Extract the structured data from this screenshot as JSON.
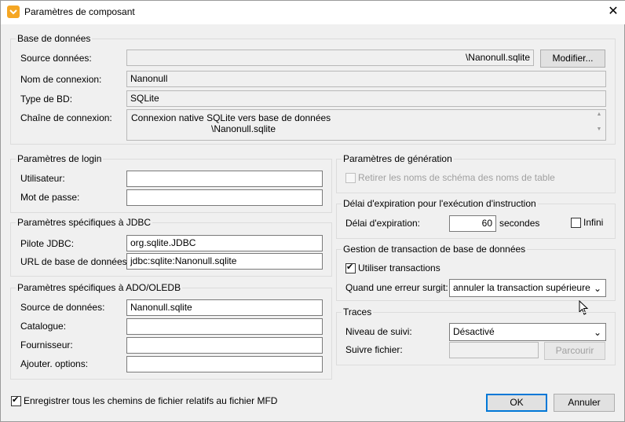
{
  "window": {
    "title": "Paramètres de composant",
    "close_glyph": "✕"
  },
  "db_group": {
    "title": "Base de données",
    "source_label": "Source données:",
    "source_value": "\\Nanonull.sqlite",
    "modify_button": "Modifier...",
    "connection_name_label": "Nom de connexion:",
    "connection_name_value": "Nanonull",
    "db_type_label": "Type de BD:",
    "db_type_value": "SQLite",
    "connection_string_label": "Chaîne de connexion:",
    "connection_string_line1": "Connexion native SQLite vers base de données",
    "connection_string_line2": "\\Nanonull.sqlite"
  },
  "login_group": {
    "title": "Paramètres de login",
    "user_label": "Utilisateur:",
    "user_value": "",
    "password_label": "Mot de passe:",
    "password_value": ""
  },
  "jdbc_group": {
    "title": "Paramètres spécifiques à JDBC",
    "driver_label": "Pilote JDBC:",
    "driver_value": "org.sqlite.JDBC",
    "url_label": "URL de base de données:",
    "url_value": "jdbc:sqlite:Nanonull.sqlite"
  },
  "ado_group": {
    "title": "Paramètres spécifiques à ADO/OLEDB",
    "source_label": "Source de données:",
    "source_value": "Nanonull.sqlite",
    "catalog_label": "Catalogue:",
    "catalog_value": "",
    "provider_label": "Fournisseur:",
    "provider_value": "",
    "options_label": "Ajouter. options:",
    "options_value": ""
  },
  "generation_group": {
    "title": "Paramètres de génération",
    "remove_schema_label": "Retirer les noms de schéma des noms de table",
    "remove_schema_checked": false
  },
  "timeout_group": {
    "title": "Délai d'expiration pour l'exécution d'instruction",
    "timeout_label": "Délai d'expiration:",
    "timeout_value": "60",
    "unit": "secondes",
    "infinite_label": "Infini",
    "infinite_checked": false
  },
  "transaction_group": {
    "title": "Gestion de transaction de base de données",
    "use_transactions_label": "Utiliser transactions",
    "use_transactions_checked": true,
    "on_error_label": "Quand une erreur surgit:",
    "on_error_value": "annuler la transaction supérieure"
  },
  "trace_group": {
    "title": "Traces",
    "level_label": "Niveau de suivi:",
    "level_value": "Désactivé",
    "file_label": "Suivre fichier:",
    "file_value": "",
    "browse_button": "Parcourir"
  },
  "footer": {
    "relative_paths_label": "Enregistrer tous les chemins de fichier relatifs au fichier MFD",
    "relative_paths_checked": true,
    "ok_button": "OK",
    "cancel_button": "Annuler"
  },
  "colors": {
    "accent": "#0078d7",
    "icon_orange": "#f5a623"
  }
}
